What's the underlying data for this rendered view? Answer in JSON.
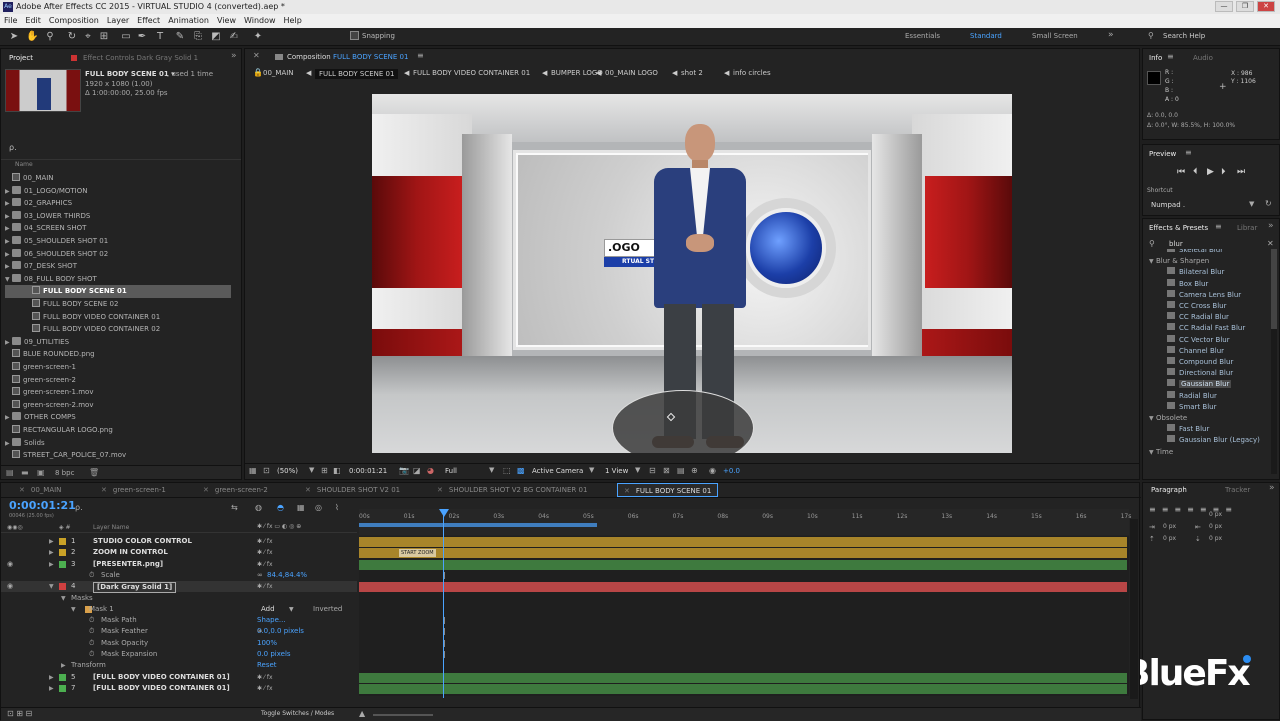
{
  "window": {
    "title": "Adobe After Effects CC 2015 - VIRTUAL STUDIO 4 (converted).aep *",
    "minimize": "—",
    "maximize": "❐",
    "close": "✕"
  },
  "menu": [
    "File",
    "Edit",
    "Composition",
    "Layer",
    "Effect",
    "Animation",
    "View",
    "Window",
    "Help"
  ],
  "toolbar": {
    "snapping": "Snapping",
    "workspaces": [
      "Essentials",
      "Standard",
      "Small Screen"
    ],
    "search_help": "Search Help"
  },
  "project": {
    "tab_project": "Project",
    "tab_effect_controls": "Effect Controls Dark Gray Solid 1",
    "selected_name": "FULL BODY SCENE 01 ▾",
    "used": ", used 1 time",
    "info1": "1920 x 1080 (1.00)",
    "info2": "Δ 1:00:00:00, 25.00 fps",
    "search_placeholder": "ρ.",
    "column_name": "Name",
    "items": [
      {
        "name": "00_MAIN",
        "type": "comp",
        "indent": 0
      },
      {
        "name": "01_LOGO/MOTION",
        "type": "folder",
        "indent": 0
      },
      {
        "name": "02_GRAPHICS",
        "type": "folder",
        "indent": 0
      },
      {
        "name": "03_LOWER THIRDS",
        "type": "folder",
        "indent": 0
      },
      {
        "name": "04_SCREEN SHOT",
        "type": "folder",
        "indent": 0
      },
      {
        "name": "05_SHOULDER SHOT 01",
        "type": "folder",
        "indent": 0
      },
      {
        "name": "06_SHOULDER SHOT 02",
        "type": "folder",
        "indent": 0
      },
      {
        "name": "07_DESK SHOT",
        "type": "folder",
        "indent": 0
      },
      {
        "name": "08_FULL BODY SHOT",
        "type": "folder-open",
        "indent": 0
      },
      {
        "name": "FULL BODY SCENE 01",
        "type": "comp",
        "indent": 1,
        "selected": true
      },
      {
        "name": "FULL BODY SCENE 02",
        "type": "comp",
        "indent": 1
      },
      {
        "name": "FULL BODY VIDEO CONTAINER 01",
        "type": "comp",
        "indent": 1
      },
      {
        "name": "FULL BODY VIDEO CONTAINER 02",
        "type": "comp",
        "indent": 1
      },
      {
        "name": "09_UTILITIES",
        "type": "folder",
        "indent": 0
      },
      {
        "name": "BLUE ROUNDED.png",
        "type": "file",
        "indent": 0
      },
      {
        "name": "green-screen-1",
        "type": "comp",
        "indent": 0
      },
      {
        "name": "green-screen-2",
        "type": "comp",
        "indent": 0
      },
      {
        "name": "green-screen-1.mov",
        "type": "file",
        "indent": 0
      },
      {
        "name": "green-screen-2.mov",
        "type": "file",
        "indent": 0
      },
      {
        "name": "OTHER COMPS",
        "type": "folder",
        "indent": 0
      },
      {
        "name": "RECTANGULAR LOGO.png",
        "type": "file",
        "indent": 0
      },
      {
        "name": "Solids",
        "type": "folder",
        "indent": 0
      },
      {
        "name": "STREET_CAR_POLICE_07.mov",
        "type": "file",
        "indent": 0
      }
    ],
    "bpc": "8 bpc"
  },
  "composition": {
    "tab_label": "Composition",
    "tab_name": "FULL BODY SCENE 01",
    "breadcrumbs": [
      "00_MAIN",
      "FULL BODY SCENE 01",
      "FULL BODY VIDEO CONTAINER 01",
      "BUMPER LOGO",
      "00_MAIN LOGO",
      "shot 2",
      "info circles"
    ],
    "zoom": "(50%)",
    "timecode": "0:00:01:21",
    "resolution": "Full",
    "camera": "Active Camera",
    "view": "1 View",
    "exposure": "+0.0",
    "logo_text": ".OGO",
    "ticker_text": "RTUAL ST"
  },
  "info_panel": {
    "tab_info": "Info",
    "tab_audio": "Audio",
    "r": "R :",
    "g": "G :",
    "b": "B :",
    "a": "A : 0",
    "x": "X : 986",
    "y": "Y : 1106",
    "delta1": "Δ: 0.0, 0.0",
    "delta2": "Δ: 0.0°, W: 85.5%, H: 100.0%"
  },
  "preview": {
    "title": "Preview",
    "shortcut_label": "Shortcut",
    "shortcut_value": "Numpad ."
  },
  "effects": {
    "tab": "Effects & Presets",
    "tab2": "Librar",
    "search": "blur",
    "items": [
      {
        "name": "Skeletal Blur",
        "kind": "effect"
      },
      {
        "name": "Blur & Sharpen",
        "kind": "group"
      },
      {
        "name": "Bilateral Blur",
        "kind": "effect"
      },
      {
        "name": "Box Blur",
        "kind": "effect"
      },
      {
        "name": "Camera Lens Blur",
        "kind": "effect"
      },
      {
        "name": "CC Cross Blur",
        "kind": "effect"
      },
      {
        "name": "CC Radial Blur",
        "kind": "effect"
      },
      {
        "name": "CC Radial Fast Blur",
        "kind": "effect"
      },
      {
        "name": "CC Vector Blur",
        "kind": "effect"
      },
      {
        "name": "Channel Blur",
        "kind": "effect"
      },
      {
        "name": "Compound Blur",
        "kind": "effect"
      },
      {
        "name": "Directional Blur",
        "kind": "effect"
      },
      {
        "name": "Gaussian Blur",
        "kind": "effect",
        "selected": true
      },
      {
        "name": "Radial Blur",
        "kind": "effect"
      },
      {
        "name": "Smart Blur",
        "kind": "effect"
      },
      {
        "name": "Obsolete",
        "kind": "group"
      },
      {
        "name": "Fast Blur",
        "kind": "effect"
      },
      {
        "name": "Gaussian Blur (Legacy)",
        "kind": "effect"
      },
      {
        "name": "Time",
        "kind": "group"
      }
    ]
  },
  "paragraph": {
    "tab": "Paragraph",
    "tab2": "Tracker",
    "px": [
      "0 px",
      "0 px",
      "0 px",
      "0 px",
      "0 px"
    ]
  },
  "timeline": {
    "tabs": [
      "00_MAIN",
      "green-screen-1",
      "green-screen-2",
      "SHOULDER SHOT V2 01",
      "SHOULDER SHOT V2 BG CONTAINER 01",
      "FULL BODY SCENE 01"
    ],
    "timecode": "0:00:01:21",
    "frames": "00046 (25.00 fps)",
    "layer_name_header": "Layer Name",
    "ruler": [
      "00s",
      "01s",
      "02s",
      "03s",
      "04s",
      "05s",
      "06s",
      "07s",
      "08s",
      "09s",
      "10s",
      "11s",
      "12s",
      "13s",
      "14s",
      "15s",
      "16s",
      "17s"
    ],
    "layers": [
      {
        "num": "1",
        "name": "STUDIO COLOR CONTROL",
        "color": "#c9a227"
      },
      {
        "num": "2",
        "name": "ZOOM IN CONTROL",
        "color": "#c9a227"
      },
      {
        "num": "3",
        "name": "[PRESENTER.png]",
        "color": "#4caf50"
      },
      {
        "num": "",
        "name": "Scale",
        "prop": true,
        "value": "84.4,84.4%"
      },
      {
        "num": "4",
        "name": "[Dark Gray Solid 1]",
        "color": "#d04040",
        "selected": true
      },
      {
        "num": "",
        "name": "Masks",
        "group": true
      },
      {
        "num": "",
        "name": "Mask 1",
        "mask": true,
        "mode": "Add",
        "inverted": "Inverted"
      },
      {
        "num": "",
        "name": "Mask Path",
        "prop": true,
        "value": "Shape..."
      },
      {
        "num": "",
        "name": "Mask Feather",
        "prop": true,
        "value": "0.0,0.0 pixels"
      },
      {
        "num": "",
        "name": "Mask Opacity",
        "prop": true,
        "value": "100%"
      },
      {
        "num": "",
        "name": "Mask Expansion",
        "prop": true,
        "value": "0.0 pixels"
      },
      {
        "num": "",
        "name": "Transform",
        "group": true,
        "value": "Reset"
      },
      {
        "num": "5",
        "name": "[FULL BODY VIDEO CONTAINER 01]",
        "color": "#4caf50"
      },
      {
        "num": "7",
        "name": "[FULL BODY VIDEO CONTAINER 01]",
        "color": "#4caf50"
      }
    ],
    "marker": "START ZOOM",
    "toggle": "Toggle Switches / Modes"
  },
  "watermark": "BlueFx"
}
